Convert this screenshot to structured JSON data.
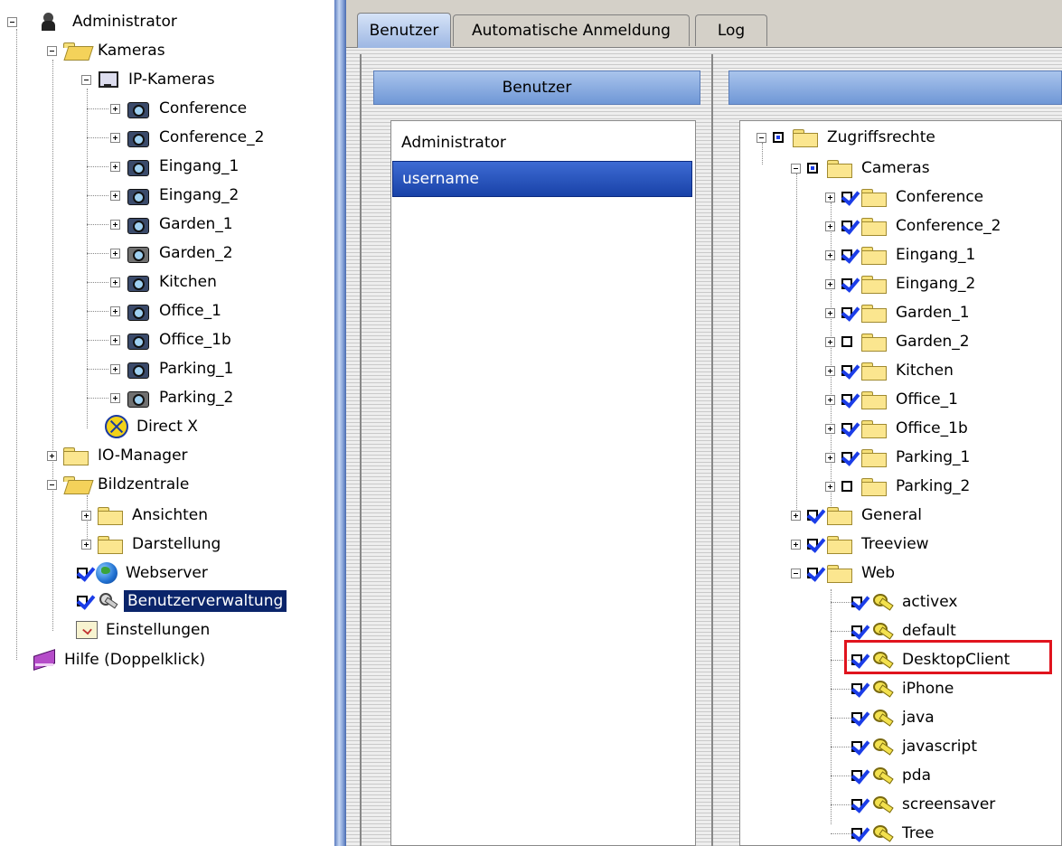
{
  "left_tree": {
    "administrator": "Administrator",
    "kameras": "Kameras",
    "ip_kameras": "IP-Kameras",
    "cameras": [
      {
        "label": "Conference",
        "icon": "camera-icon"
      },
      {
        "label": "Conference_2",
        "icon": "camera-icon"
      },
      {
        "label": "Eingang_1",
        "icon": "camera-icon"
      },
      {
        "label": "Eingang_2",
        "icon": "camera-icon"
      },
      {
        "label": "Garden_1",
        "icon": "camera-icon"
      },
      {
        "label": "Garden_2",
        "icon": "camera-icon"
      },
      {
        "label": "Kitchen",
        "icon": "camera-icon"
      },
      {
        "label": "Office_1",
        "icon": "camera-icon"
      },
      {
        "label": "Office_1b",
        "icon": "camera-icon"
      },
      {
        "label": "Parking_1",
        "icon": "camera-icon"
      },
      {
        "label": "Parking_2",
        "icon": "camera-icon"
      }
    ],
    "direct_x": "Direct X",
    "io_manager": "IO-Manager",
    "bildzentrale": "Bildzentrale",
    "ansichten": "Ansichten",
    "darstellung": "Darstellung",
    "webserver": "Webserver",
    "benutzerverwaltung": "Benutzerverwaltung",
    "einstellungen": "Einstellungen",
    "hilfe": "Hilfe (Doppelklick)",
    "selected_color": "#0a246a"
  },
  "tabs": [
    "Benutzer",
    "Automatische Anmeldung",
    "Log"
  ],
  "users_panel": {
    "header": "Benutzer",
    "items": [
      "Administrator",
      "username"
    ],
    "selected_index": 1
  },
  "rights_panel": {
    "header": "",
    "root": "Zugriffsrechte",
    "cameras_label": "Cameras",
    "cameras": [
      {
        "label": "Conference",
        "checked": true
      },
      {
        "label": "Conference_2",
        "checked": true
      },
      {
        "label": "Eingang_1",
        "checked": true
      },
      {
        "label": "Eingang_2",
        "checked": true
      },
      {
        "label": "Garden_1",
        "checked": true
      },
      {
        "label": "Garden_2",
        "checked": false
      },
      {
        "label": "Kitchen",
        "checked": true
      },
      {
        "label": "Office_1",
        "checked": true
      },
      {
        "label": "Office_1b",
        "checked": true
      },
      {
        "label": "Parking_1",
        "checked": true
      },
      {
        "label": "Parking_2",
        "checked": false
      }
    ],
    "general": "General",
    "treeview": "Treeview",
    "web": "Web",
    "web_items": [
      "activex",
      "default",
      "DesktopClient",
      "iPhone",
      "java",
      "javascript",
      "pda",
      "screensaver",
      "Tree"
    ],
    "highlight_color": "#e0141e"
  }
}
